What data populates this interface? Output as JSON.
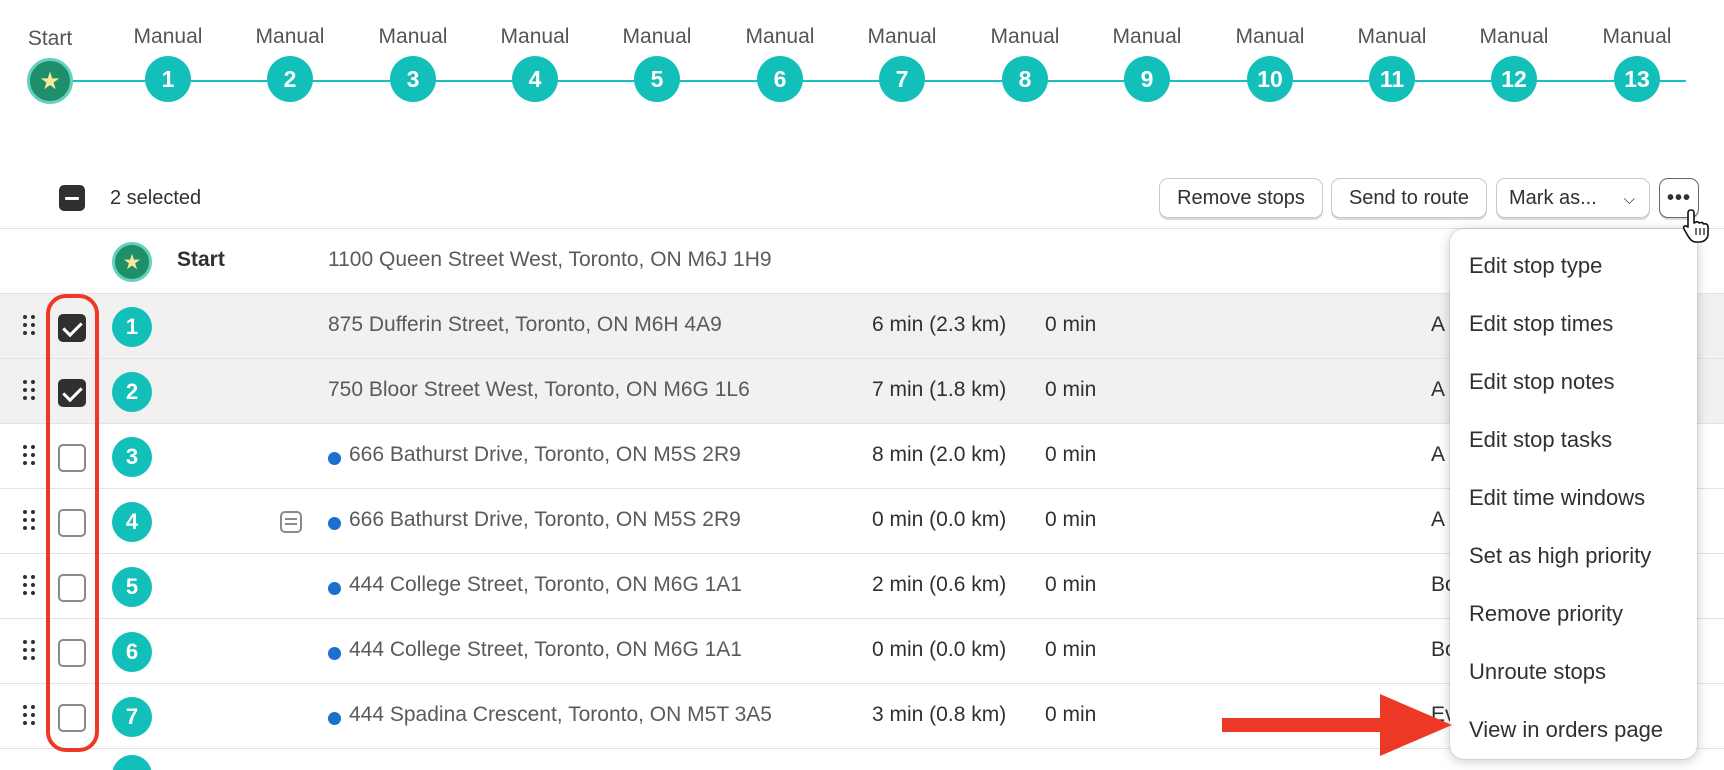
{
  "timeline": {
    "stops": [
      {
        "label": "Start",
        "badge": "★",
        "start": true
      },
      {
        "label": "Manual",
        "badge": "1"
      },
      {
        "label": "Manual",
        "badge": "2"
      },
      {
        "label": "Manual",
        "badge": "3"
      },
      {
        "label": "Manual",
        "badge": "4"
      },
      {
        "label": "Manual",
        "badge": "5"
      },
      {
        "label": "Manual",
        "badge": "6"
      },
      {
        "label": "Manual",
        "badge": "7"
      },
      {
        "label": "Manual",
        "badge": "8"
      },
      {
        "label": "Manual",
        "badge": "9"
      },
      {
        "label": "Manual",
        "badge": "10"
      },
      {
        "label": "Manual",
        "badge": "11"
      },
      {
        "label": "Manual",
        "badge": "12"
      },
      {
        "label": "Manual",
        "badge": "13"
      }
    ]
  },
  "bulk_bar": {
    "selected_text": "2 selected",
    "remove_label": "Remove stops",
    "send_label": "Send to route",
    "mark_label": "Mark as...",
    "more_label": "•••"
  },
  "table": {
    "start_row": {
      "badge": "★",
      "label": "Start",
      "address": "1100 Queen Street West, Toronto, ON M6J 1H9"
    },
    "rows": [
      {
        "badge": "1",
        "checked": true,
        "address": "875 Dufferin Street, Toronto, ON M6H 4A9",
        "dot": false,
        "note": false,
        "drive": "6 min (2.3 km)",
        "service": "0 min",
        "extra": "A"
      },
      {
        "badge": "2",
        "checked": true,
        "address": "750 Bloor Street West, Toronto, ON M6G 1L6",
        "dot": false,
        "note": false,
        "drive": "7 min (1.8 km)",
        "service": "0 min",
        "extra": "A"
      },
      {
        "badge": "3",
        "checked": false,
        "address": "666 Bathurst Drive, Toronto, ON M5S 2R9",
        "dot": true,
        "note": false,
        "drive": "8 min (2.0 km)",
        "service": "0 min",
        "extra": "A"
      },
      {
        "badge": "4",
        "checked": false,
        "address": "666 Bathurst Drive, Toronto, ON M5S 2R9",
        "dot": true,
        "note": true,
        "drive": "0 min (0.0 km)",
        "service": "0 min",
        "extra": "A"
      },
      {
        "badge": "5",
        "checked": false,
        "address": "444 College Street, Toronto, ON M6G 1A1",
        "dot": true,
        "note": false,
        "drive": "2 min (0.6 km)",
        "service": "0 min",
        "extra": "Bo"
      },
      {
        "badge": "6",
        "checked": false,
        "address": "444 College Street, Toronto, ON M6G 1A1",
        "dot": true,
        "note": false,
        "drive": "0 min (0.0 km)",
        "service": "0 min",
        "extra": "Bo"
      },
      {
        "badge": "7",
        "checked": false,
        "address": "444 Spadina Crescent, Toronto, ON M5T 3A5",
        "dot": true,
        "note": false,
        "drive": "3 min (0.8 km)",
        "service": "0 min",
        "extra": "Ev"
      }
    ]
  },
  "menu": {
    "items": [
      "Edit stop type",
      "Edit stop times",
      "Edit stop notes",
      "Edit stop tasks",
      "Edit time windows",
      "Set as high priority",
      "Remove priority",
      "Unroute stops",
      "View in orders page"
    ]
  },
  "colors": {
    "teal": "#12bfb9",
    "start_green": "#1f8f6a",
    "annotation_red": "#ee3826",
    "location_dot": "#1a6fcf"
  }
}
